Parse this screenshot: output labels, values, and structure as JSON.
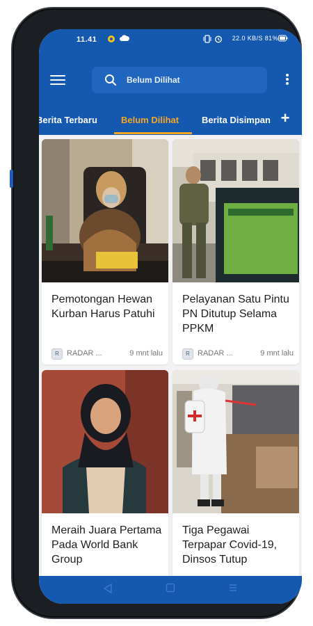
{
  "status_bar": {
    "time": "11.41",
    "right_text": "22.0 KB/S  81%",
    "icons": [
      "chat-bubble-icon",
      "cloud-icon",
      "vibrate-icon",
      "alarm-icon",
      "signal-icon",
      "battery-icon"
    ]
  },
  "app_bar": {
    "menu_icon": "hamburger-menu-icon",
    "search_placeholder": "Belum Dilihat",
    "more_icon": "more-vertical-icon"
  },
  "tabs": [
    {
      "label": "Berita Terbaru",
      "active": false
    },
    {
      "label": "Belum Dilihat",
      "active": true
    },
    {
      "label": "Berita Disimpan",
      "active": false
    }
  ],
  "tab_add_icon": "plus-icon",
  "cards": [
    {
      "title": "Pemotongan Hewan Kurban Harus Patuhi",
      "source": "RADAR ...",
      "time": "9 mnt lalu"
    },
    {
      "title": "Pelayanan Satu Pintu PN Ditutup Selama PPKM",
      "source": "RADAR ...",
      "time": "9 mnt lalu"
    },
    {
      "title": "Meraih Juara Pertama Pada World Bank Group",
      "source": "",
      "time": ""
    },
    {
      "title": "Tiga Pegawai Terpapar Covid-19, Dinsos Tutup",
      "source": "",
      "time": ""
    }
  ],
  "nav_bar": {
    "back": "back-icon",
    "home": "home-icon",
    "recents": "recents-icon"
  },
  "colors": {
    "primary": "#1558b0",
    "accent": "#f5a623",
    "background": "#f2f2f4"
  }
}
